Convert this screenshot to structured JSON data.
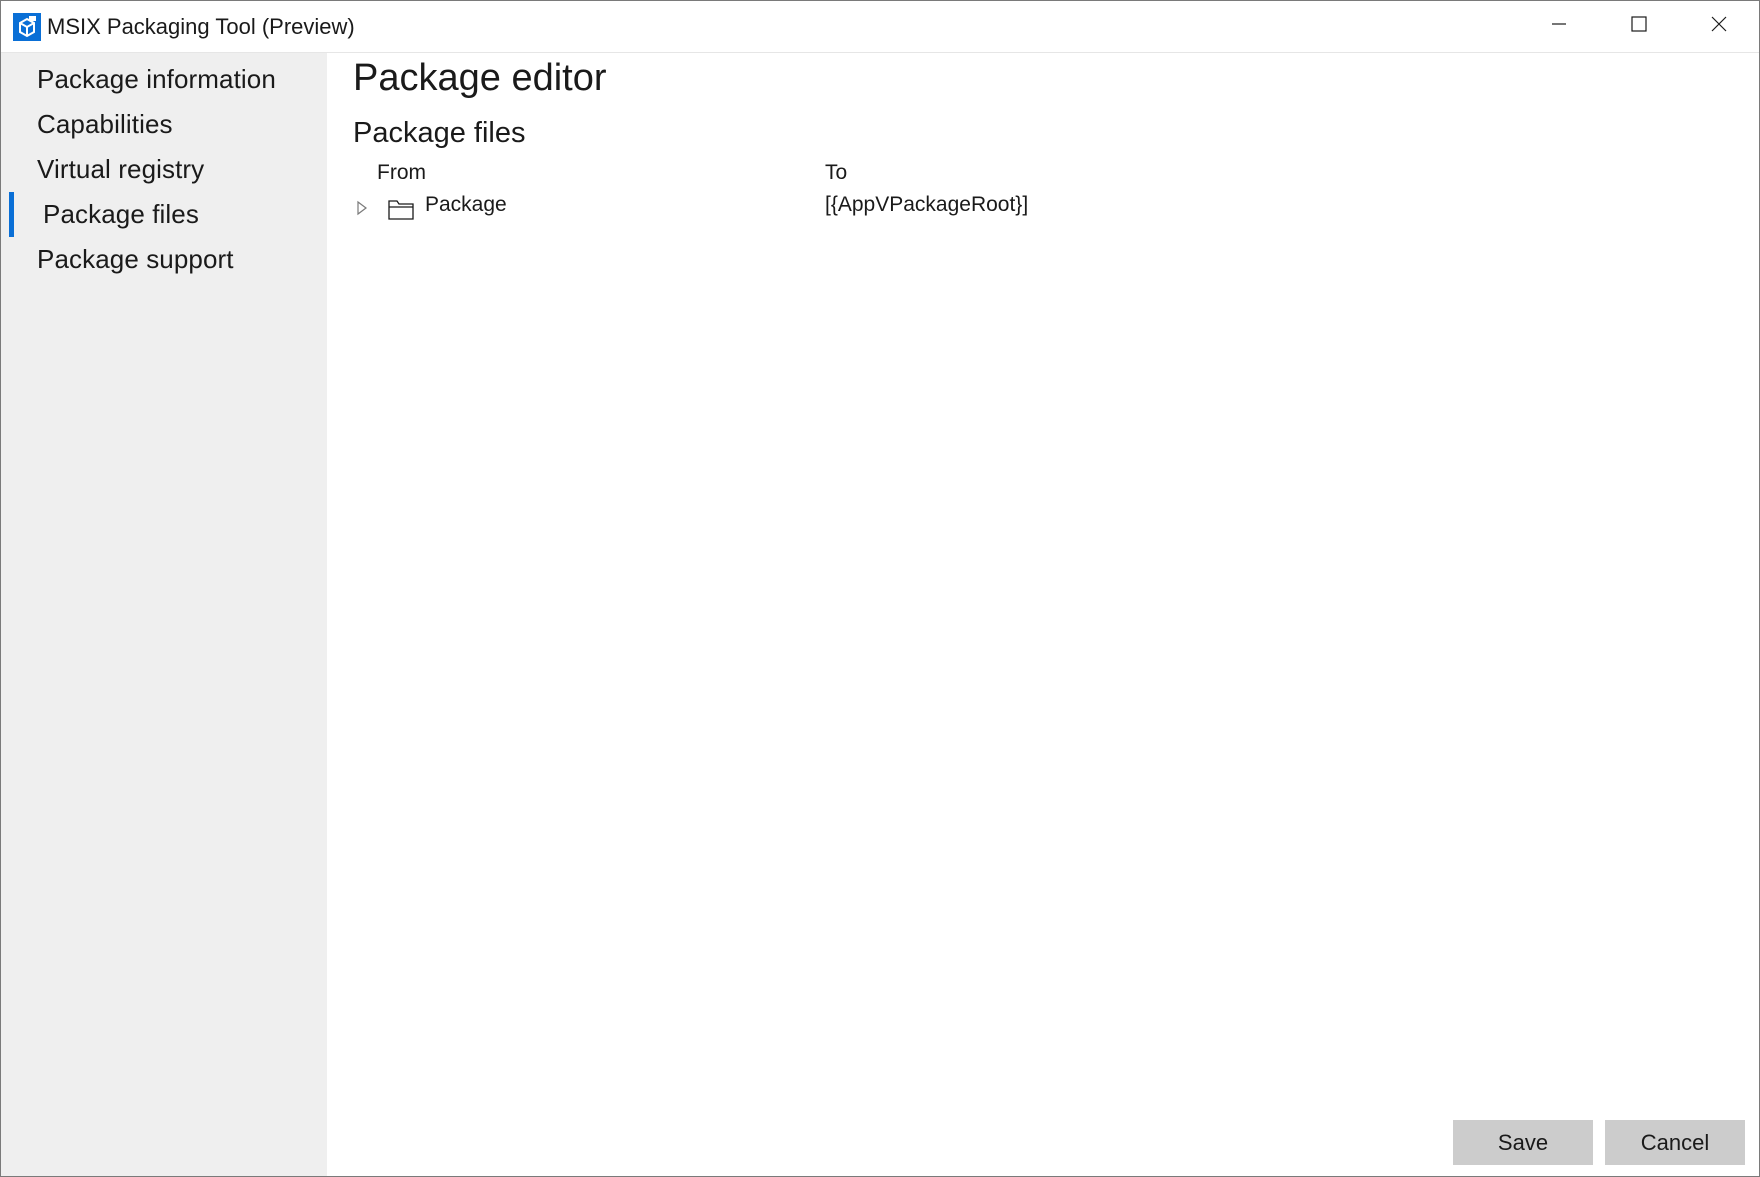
{
  "window": {
    "title": "MSIX Packaging Tool (Preview)",
    "icon": "msix-package-icon",
    "controls": [
      "minimize-icon",
      "maximize-icon",
      "close-icon"
    ]
  },
  "sidebar": {
    "items": [
      {
        "label": "Package information",
        "selected": false
      },
      {
        "label": "Capabilities",
        "selected": false
      },
      {
        "label": "Virtual registry",
        "selected": false
      },
      {
        "label": "Package files",
        "selected": true
      },
      {
        "label": "Package support",
        "selected": false
      }
    ]
  },
  "main": {
    "title": "Package editor",
    "section_title": "Package files",
    "table": {
      "columns": {
        "from": "From",
        "to": "To"
      },
      "rows": [
        {
          "from": "Package",
          "to": "[{AppVPackageRoot}]",
          "icon": "folder-icon",
          "expandable": true
        }
      ]
    }
  },
  "footer": {
    "save_label": "Save",
    "cancel_label": "Cancel"
  },
  "colors": {
    "accent": "#0a6fd6",
    "sidebar_bg": "#efefef",
    "button_bg": "#cccccc"
  }
}
